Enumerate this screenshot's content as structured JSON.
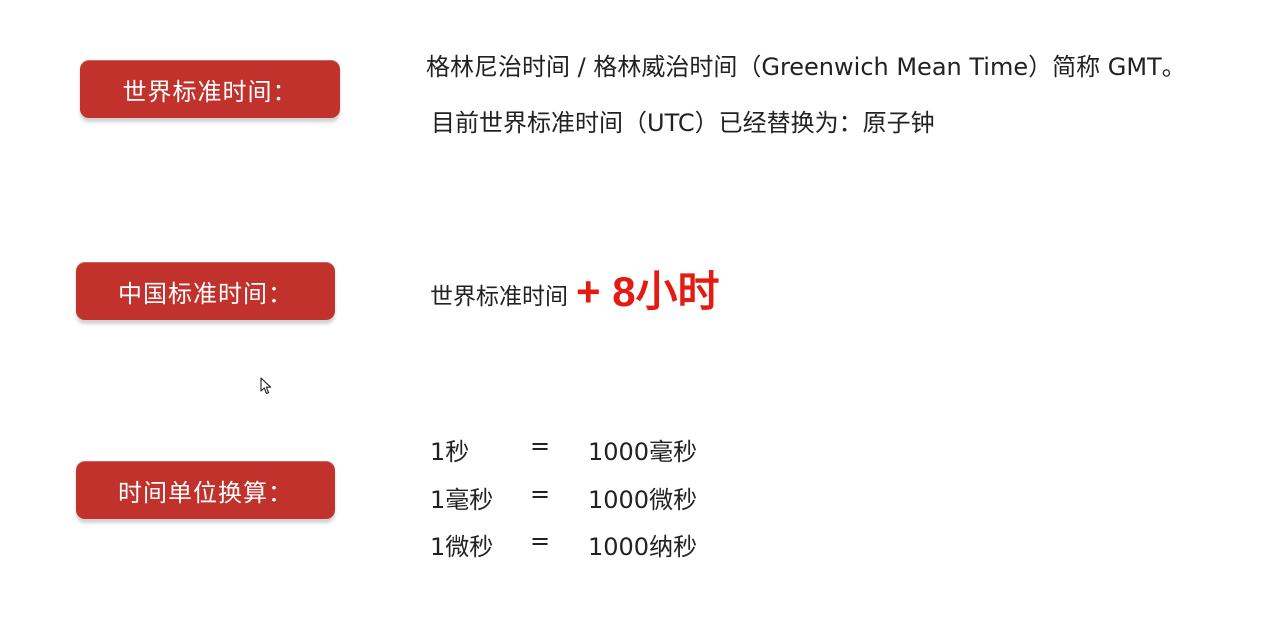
{
  "sections": {
    "world_standard": {
      "label": "世界标准时间：",
      "lines": [
        "格林尼治时间 / 格林威治时间（Greenwich Mean Time）简称 GMT。",
        "目前世界标准时间（UTC）已经替换为：原子钟"
      ]
    },
    "china_standard": {
      "label": "中国标准时间：",
      "base_text": "世界标准时间",
      "offset_text": "+ 8小时",
      "offset_color": "#e31b12"
    },
    "unit_conversion": {
      "label": "时间单位换算：",
      "rows": [
        {
          "left": "1秒",
          "eq": "=",
          "right": "1000毫秒"
        },
        {
          "left": "1毫秒",
          "eq": "=",
          "right": "1000微秒"
        },
        {
          "left": "1微秒",
          "eq": "=",
          "right": "1000纳秒"
        }
      ]
    }
  },
  "theme": {
    "pill_color": "#c0322b",
    "text_color": "#222222"
  },
  "cursor": {
    "icon": "mouse-pointer-icon"
  }
}
